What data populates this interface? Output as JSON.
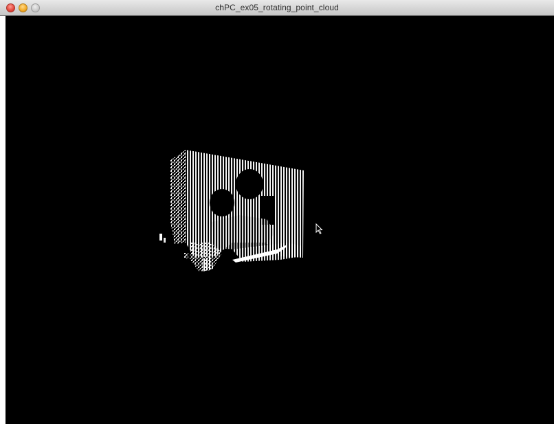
{
  "window": {
    "title": "chPC_ex05_rotating_point_cloud"
  },
  "titlebar": {
    "buttons": [
      "close",
      "minimize",
      "zoom"
    ]
  },
  "viewport": {
    "background": "#000000",
    "point_color": "#ffffff"
  },
  "cursor": {
    "icon": "arrow-cursor-icon"
  }
}
